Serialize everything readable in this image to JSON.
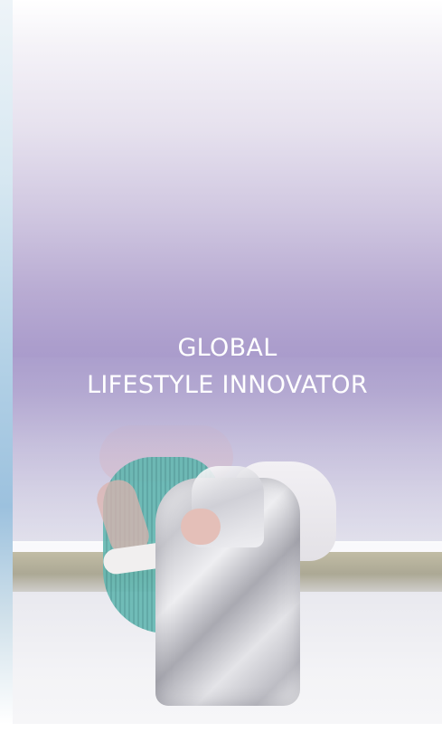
{
  "hero": {
    "headline_line1": "GLOBAL",
    "headline_line2": "LIFESTYLE INNOVATOR",
    "text_color": "#ffffff",
    "overlay_color": "#a89ac9"
  }
}
